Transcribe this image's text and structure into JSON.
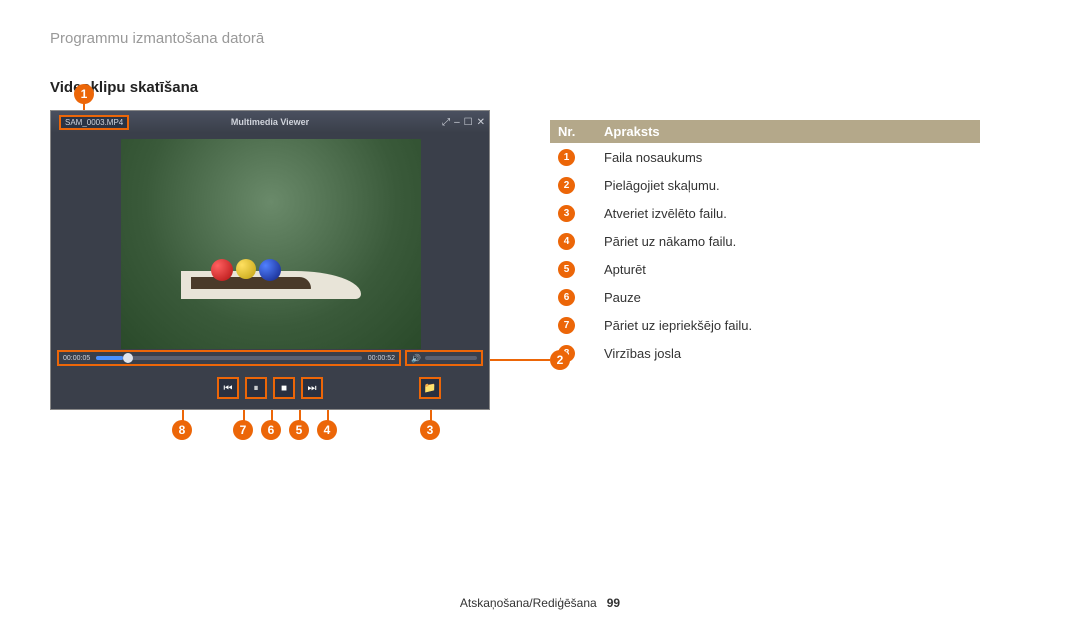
{
  "breadcrumb": "Programmu izmantošana datorā",
  "section_title": "Videoklipu skatīšana",
  "player": {
    "filename": "SAM_0003.MP4",
    "app_title": "Multimedia Viewer",
    "time_current": "00:00:05",
    "time_total": "00:00:52"
  },
  "callouts": {
    "c1": "1",
    "c2": "2",
    "c3": "3",
    "c4": "4",
    "c5": "5",
    "c6": "6",
    "c7": "7",
    "c8": "8"
  },
  "table": {
    "header_nr": "Nr.",
    "header_desc": "Apraksts",
    "rows": [
      {
        "num": "1",
        "desc": "Faila nosaukums"
      },
      {
        "num": "2",
        "desc": "Pielāgojiet skaļumu."
      },
      {
        "num": "3",
        "desc": "Atveriet izvēlēto failu."
      },
      {
        "num": "4",
        "desc": "Pāriet uz nākamo failu."
      },
      {
        "num": "5",
        "desc": "Apturēt"
      },
      {
        "num": "6",
        "desc": "Pauze"
      },
      {
        "num": "7",
        "desc": "Pāriet uz iepriekšējo failu."
      },
      {
        "num": "8",
        "desc": "Virzības josla"
      }
    ]
  },
  "footer": {
    "section": "Atskaņošana/Rediģēšana",
    "page": "99"
  }
}
